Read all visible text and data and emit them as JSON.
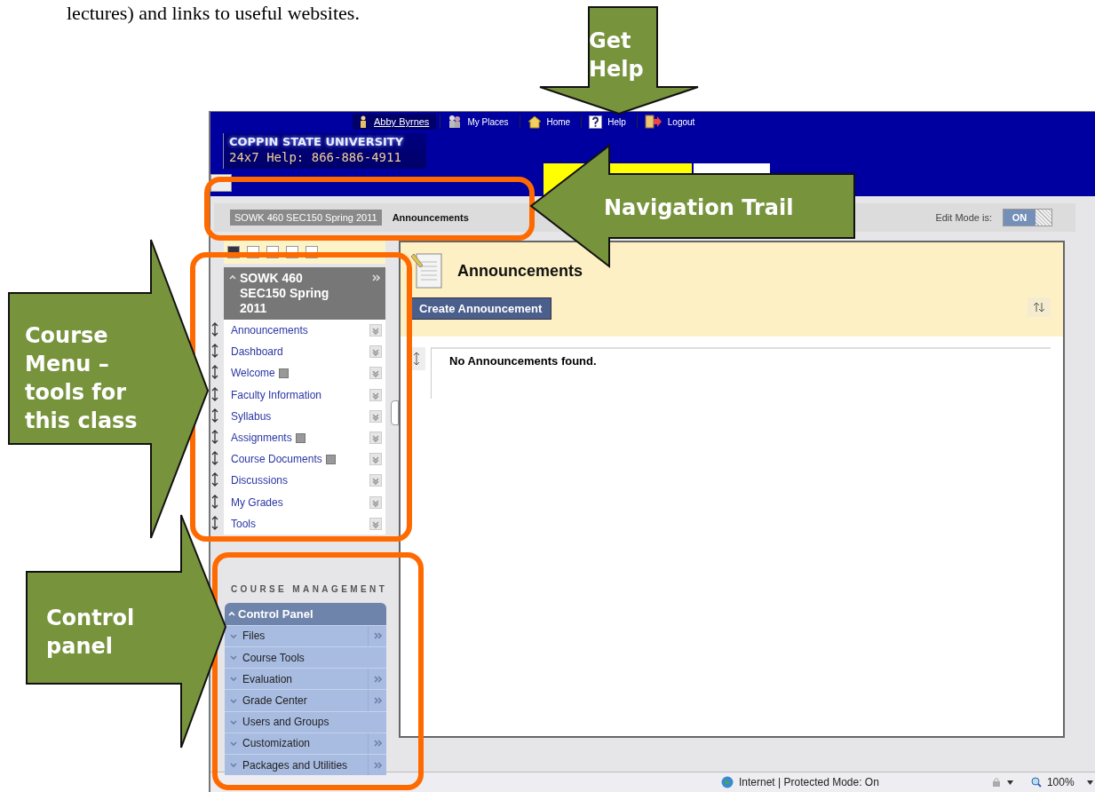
{
  "document_text": "lectures) and links to useful websites.",
  "header": {
    "user": "Abby Byrnes",
    "links": [
      {
        "label": "My Places",
        "kind": "places"
      },
      {
        "label": "Home",
        "kind": "home"
      },
      {
        "label": "Help",
        "kind": "help"
      },
      {
        "label": "Logout",
        "kind": "logout"
      }
    ],
    "university": "COPPIN STATE UNIVERSITY",
    "help_line": "24x7 Help:  866-886-4911"
  },
  "breadcrumb": [
    "SOWK 460 SEC150 Spring 2011",
    "Announcements"
  ],
  "edit_mode": {
    "label": "Edit Mode is:",
    "value": "ON",
    "on": true
  },
  "course_menu": {
    "title": "SOWK 460 SEC150 Spring 2011",
    "items": [
      {
        "label": "Announcements",
        "has_icon": false
      },
      {
        "label": "Dashboard",
        "has_icon": false
      },
      {
        "label": "Welcome",
        "has_icon": true
      },
      {
        "label": "Faculty Information",
        "has_icon": false
      },
      {
        "label": "Syllabus",
        "has_icon": false
      },
      {
        "label": "Assignments",
        "has_icon": true
      },
      {
        "label": "Course Documents",
        "has_icon": true
      },
      {
        "label": "Discussions",
        "has_icon": false
      },
      {
        "label": "My Grades",
        "has_icon": false
      },
      {
        "label": "Tools",
        "has_icon": false
      }
    ]
  },
  "course_management": {
    "heading": "COURSE MANAGEMENT",
    "panel_title": "Control Panel",
    "items": [
      {
        "label": "Files",
        "has_submenu": true
      },
      {
        "label": "Course Tools",
        "has_submenu": false
      },
      {
        "label": "Evaluation",
        "has_submenu": true
      },
      {
        "label": "Grade Center",
        "has_submenu": true
      },
      {
        "label": "Users and Groups",
        "has_submenu": false
      },
      {
        "label": "Customization",
        "has_submenu": true
      },
      {
        "label": "Packages and Utilities",
        "has_submenu": true
      }
    ]
  },
  "content": {
    "title": "Announcements",
    "button": "Create Announcement",
    "message": "No Announcements found."
  },
  "status_bar": {
    "zone": "Internet | Protected Mode: On",
    "zoom": "100%"
  },
  "annotations": [
    {
      "text": "Get Help",
      "kind": "down"
    },
    {
      "text": "Navigation Trail",
      "kind": "left"
    },
    {
      "text": "Course Menu – tools for this class",
      "kind": "right-menu"
    },
    {
      "text": "Control panel",
      "kind": "right-panel"
    }
  ]
}
